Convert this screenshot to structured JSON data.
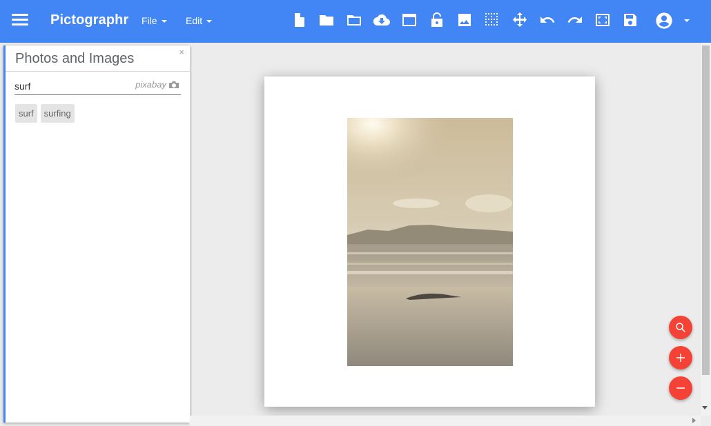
{
  "app": {
    "title": "Pictographr",
    "menus": {
      "file": "File",
      "edit": "Edit"
    },
    "toolbar_icons": [
      "new-file-icon",
      "folder-icon",
      "folder-open-icon",
      "cloud-download-icon",
      "window-icon",
      "lock-open-icon",
      "image-icon",
      "grid-icon",
      "move-icon",
      "undo-icon",
      "redo-icon",
      "fullscreen-icon",
      "save-icon"
    ],
    "account_icon": "account-circle-icon",
    "brand_color": "#4285f4",
    "fab_color": "#f44336"
  },
  "panel": {
    "title": "Photos and Images",
    "close": "×",
    "search": {
      "value": "surf",
      "provider": "pixabay"
    },
    "suggestions": [
      "surf",
      "surfing"
    ]
  },
  "canvas": {
    "image": "beach-sunset-photo"
  },
  "fabs": [
    "search-icon",
    "zoom-in-icon",
    "zoom-out-icon"
  ]
}
